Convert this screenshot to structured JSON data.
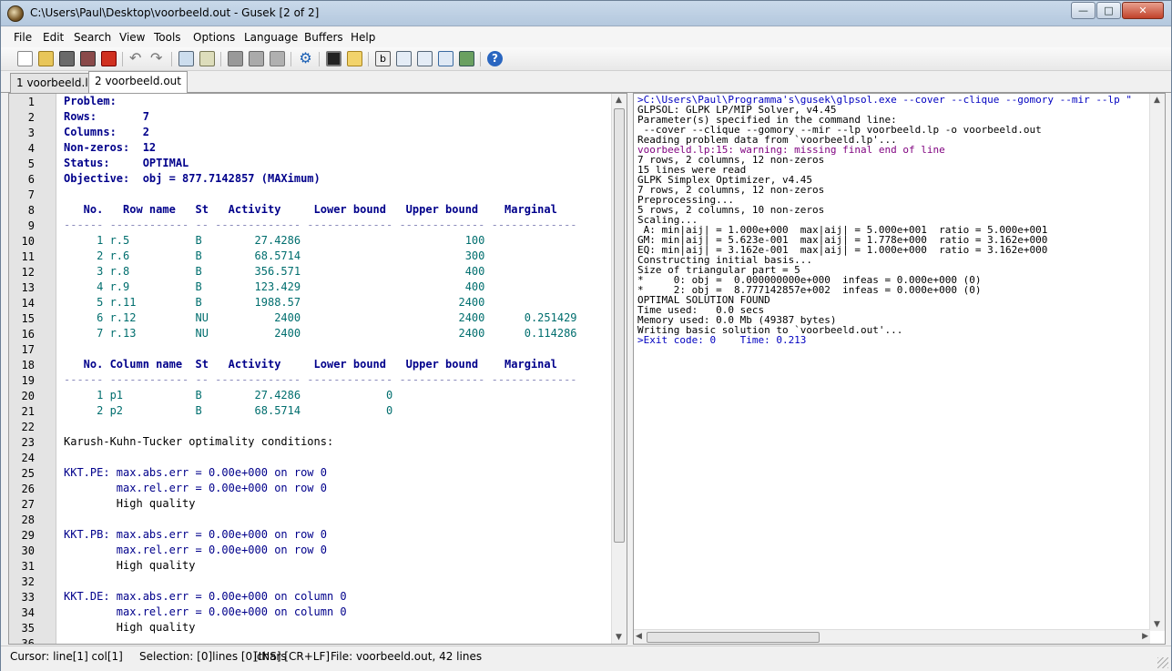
{
  "window": {
    "title": "C:\\Users\\Paul\\Desktop\\voorbeeld.out - Gusek [2 of 2]"
  },
  "menu": [
    "File",
    "Edit",
    "Search",
    "View",
    "Tools",
    "Options",
    "Language",
    "Buffers",
    "Help"
  ],
  "toolbar_icons": [
    "new-file-icon",
    "open-file-icon",
    "save-icon",
    "save-all-icon",
    "close-file-icon",
    "undo-icon",
    "redo-icon",
    "find-icon",
    "replace-icon",
    "compile-icon",
    "go-icon",
    "build-icon",
    "stop-icon",
    "settings-icon",
    "terminal-icon",
    "open-folder-icon",
    "text-style-icon",
    "export-icon",
    "import-icon",
    "fullscreen-icon",
    "image-icon",
    "help-icon"
  ],
  "tabs": [
    {
      "label": "1 voorbeeld.lp"
    },
    {
      "label": "2 voorbeeld.out"
    }
  ],
  "editor": {
    "line_numbers": [
      "1",
      "2",
      "3",
      "4",
      "5",
      "6",
      "7",
      "8",
      "9",
      "10",
      "11",
      "12",
      "13",
      "14",
      "15",
      "16",
      "17",
      "18",
      "19",
      "20",
      "21",
      "22",
      "23",
      "24",
      "25",
      "26",
      "27",
      "28",
      "29",
      "30",
      "31",
      "32",
      "33",
      "34",
      "35",
      "36"
    ],
    "lines": [
      "Problem:",
      "Rows:       7",
      "Columns:    2",
      "Non-zeros:  12",
      "Status:     OPTIMAL",
      "Objective:  obj = 877.7142857 (MAXimum)",
      "",
      "   No.   Row name   St   Activity     Lower bound   Upper bound    Marginal",
      "------ ------------ -- ------------- ------------- ------------- -------------",
      "     1 r.5          B        27.4286                         100",
      "     2 r.6          B        68.5714                         300",
      "     3 r.8          B        356.571                         400",
      "     4 r.9          B        123.429                         400",
      "     5 r.11         B        1988.57                        2400",
      "     6 r.12         NU          2400                        2400      0.251429",
      "     7 r.13         NU          2400                        2400      0.114286",
      "",
      "   No. Column name  St   Activity     Lower bound   Upper bound    Marginal",
      "------ ------------ -- ------------- ------------- ------------- -------------",
      "     1 p1           B        27.4286             0",
      "     2 p2           B        68.5714             0",
      "",
      "Karush-Kuhn-Tucker optimality conditions:",
      "",
      "KKT.PE: max.abs.err = 0.00e+000 on row 0",
      "        max.rel.err = 0.00e+000 on row 0",
      "        High quality",
      "",
      "KKT.PB: max.abs.err = 0.00e+000 on row 0",
      "        max.rel.err = 0.00e+000 on row 0",
      "        High quality",
      "",
      "KKT.DE: max.abs.err = 0.00e+000 on column 0",
      "        max.rel.err = 0.00e+000 on column 0",
      "        High quality",
      ""
    ]
  },
  "output": {
    "lines": [
      ">C:\\Users\\Paul\\Programma's\\gusek\\glpsol.exe --cover --clique --gomory --mir --lp \"",
      "GLPSOL: GLPK LP/MIP Solver, v4.45",
      "Parameter(s) specified in the command line:",
      " --cover --clique --gomory --mir --lp voorbeeld.lp -o voorbeeld.out",
      "Reading problem data from `voorbeeld.lp'...",
      "voorbeeld.lp:15: warning: missing final end of line",
      "7 rows, 2 columns, 12 non-zeros",
      "15 lines were read",
      "GLPK Simplex Optimizer, v4.45",
      "7 rows, 2 columns, 12 non-zeros",
      "Preprocessing...",
      "5 rows, 2 columns, 10 non-zeros",
      "Scaling...",
      " A: min|aij| = 1.000e+000  max|aij| = 5.000e+001  ratio = 5.000e+001",
      "GM: min|aij| = 5.623e-001  max|aij| = 1.778e+000  ratio = 3.162e+000",
      "EQ: min|aij| = 3.162e-001  max|aij| = 1.000e+000  ratio = 3.162e+000",
      "Constructing initial basis...",
      "Size of triangular part = 5",
      "*     0: obj =  0.000000000e+000  infeas = 0.000e+000 (0)",
      "*     2: obj =  8.777142857e+002  infeas = 0.000e+000 (0)",
      "OPTIMAL SOLUTION FOUND",
      "Time used:   0.0 secs",
      "Memory used: 0.0 Mb (49387 bytes)",
      "Writing basic solution to `voorbeeld.out'...",
      ">Exit code: 0    Time: 0.213"
    ]
  },
  "status": {
    "cursor": "Cursor: line[1] col[1]",
    "selection": "Selection: [0]lines [0]chars",
    "mode": "[INS] [CR+LF]",
    "file": "File: voorbeeld.out, 42 lines"
  }
}
